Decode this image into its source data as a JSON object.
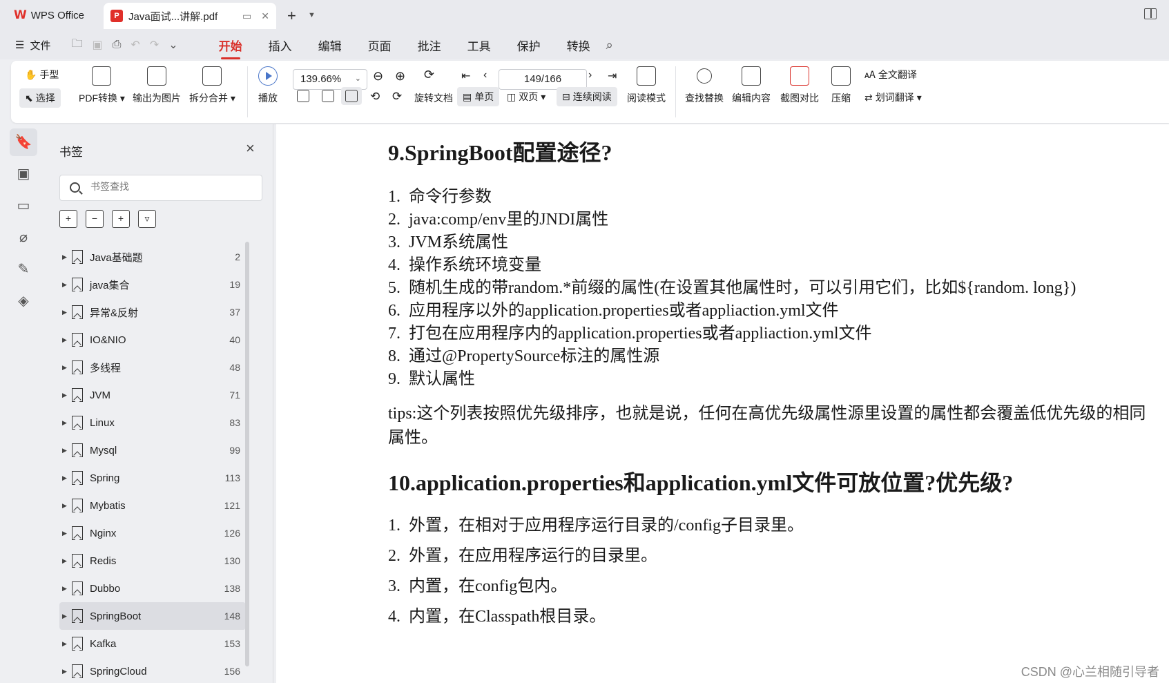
{
  "titlebar": {
    "app_name": "WPS Office",
    "doc_tab_title": "Java面试...讲解.pdf",
    "new_tab": "+"
  },
  "menubar": {
    "file": "文件",
    "items": [
      "开始",
      "插入",
      "编辑",
      "页面",
      "批注",
      "工具",
      "保护",
      "转换"
    ],
    "active": "开始"
  },
  "ribbon": {
    "hand": "手型",
    "select": "选择",
    "pdf_convert": "PDF转换",
    "export_image": "输出为图片",
    "split_merge": "拆分合并",
    "play": "播放",
    "zoom": "139.66%",
    "page": "149/166",
    "rotate_doc": "旋转文档",
    "single_page": "单页",
    "double_page": "双页",
    "continuous": "连续阅读",
    "read_mode": "阅读模式",
    "find_replace": "查找替换",
    "edit_content": "编辑内容",
    "screenshot_compare": "截图对比",
    "compress": "压缩",
    "full_translate": "全文翻译",
    "word_translate": "划词翻译"
  },
  "bookmarks": {
    "title": "书签",
    "search_placeholder": "书签查找",
    "items": [
      {
        "label": "Java基础题",
        "page": "2"
      },
      {
        "label": "java集合",
        "page": "19"
      },
      {
        "label": "异常&反射",
        "page": "37"
      },
      {
        "label": "IO&NIO",
        "page": "40"
      },
      {
        "label": "多线程",
        "page": "48"
      },
      {
        "label": "JVM",
        "page": "71"
      },
      {
        "label": "Linux",
        "page": "83"
      },
      {
        "label": "Mysql",
        "page": "99"
      },
      {
        "label": "Spring",
        "page": "113"
      },
      {
        "label": "Mybatis",
        "page": "121"
      },
      {
        "label": "Nginx",
        "page": "126"
      },
      {
        "label": "Redis",
        "page": "130"
      },
      {
        "label": "Dubbo",
        "page": "138"
      },
      {
        "label": "SpringBoot",
        "page": "148"
      },
      {
        "label": "Kafka",
        "page": "153"
      },
      {
        "label": "SpringCloud",
        "page": "156"
      }
    ],
    "selected": "SpringBoot"
  },
  "document": {
    "h1": "9.SpringBoot配置途径?",
    "list1": [
      {
        "n": "1.",
        "t": "命令行参数"
      },
      {
        "n": "2.",
        "t": "java:comp/env里的JNDI属性"
      },
      {
        "n": "3.",
        "t": "JVM系统属性"
      },
      {
        "n": "4.",
        "t": "操作系统环境变量"
      },
      {
        "n": "5.",
        "t": "随机生成的带random.*前缀的属性(在设置其他属性时，可以引用它们，比如${random. long})"
      },
      {
        "n": "6.",
        "t": "应用程序以外的application.properties或者appliaction.yml文件"
      },
      {
        "n": "7.",
        "t": "打包在应用程序内的application.properties或者appliaction.yml文件"
      },
      {
        "n": "8.",
        "t": "通过@PropertySource标注的属性源"
      },
      {
        "n": "9.",
        "t": "默认属性"
      }
    ],
    "tips": "tips:这个列表按照优先级排序，也就是说，任何在高优先级属性源里设置的属性都会覆盖低优先级的相同属性。",
    "h2": "10.application.properties和application.yml文件可放位置?优先级?",
    "list2": [
      {
        "n": "1.",
        "t": "外置，在相对于应用程序运行目录的/config子目录里。"
      },
      {
        "n": "2.",
        "t": "外置，在应用程序运行的目录里。"
      },
      {
        "n": "3.",
        "t": "内置，在config包内。"
      },
      {
        "n": "4.",
        "t": "内置，在Classpath根目录。"
      }
    ],
    "watermark": "CSDN @心兰相随引导者"
  },
  "colors": {
    "accent": "#d9302a",
    "panel_bg": "#eeeff2",
    "selected_row": "#dcdde2"
  }
}
